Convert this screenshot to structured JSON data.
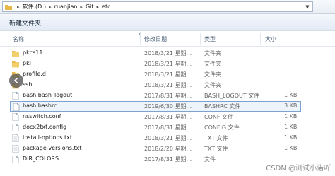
{
  "breadcrumb": [
    "软件 (D:)",
    "ruanjian",
    "Git",
    "etc"
  ],
  "toolbar": {
    "new_folder": "新建文件夹"
  },
  "columns": {
    "name": "名称",
    "modified": "修改日期",
    "type": "类型",
    "size": "大小"
  },
  "files": [
    {
      "name": "pkcs11",
      "modified": "2018/3/21 星期...",
      "type": "文件夹",
      "size": "",
      "kind": "folder"
    },
    {
      "name": "pki",
      "modified": "2018/3/21 星期...",
      "type": "文件夹",
      "size": "",
      "kind": "folder"
    },
    {
      "name": "profile.d",
      "modified": "2018/3/21 星期...",
      "type": "文件夹",
      "size": "",
      "kind": "folder"
    },
    {
      "name": "ssh",
      "modified": "2018/3/21 星期...",
      "type": "文件夹",
      "size": "",
      "kind": "folder"
    },
    {
      "name": "bash.bash_logout",
      "modified": "2017/8/31 星期...",
      "type": "BASH_LOGOUT 文件",
      "size": "1 KB",
      "kind": "file"
    },
    {
      "name": "bash.bashrc",
      "modified": "2019/6/30 星期...",
      "type": "BASHRC 文件",
      "size": "3 KB",
      "kind": "file",
      "selected": true
    },
    {
      "name": "nsswitch.conf",
      "modified": "2017/8/31 星期...",
      "type": "CONF 文件",
      "size": "1 KB",
      "kind": "file"
    },
    {
      "name": "docx2txt.config",
      "modified": "2017/8/31 星期...",
      "type": "CONFIG 文件",
      "size": "1 KB",
      "kind": "file"
    },
    {
      "name": "install-options.txt",
      "modified": "2018/3/21 星期...",
      "type": "TXT 文件",
      "size": "1 KB",
      "kind": "file"
    },
    {
      "name": "package-versions.txt",
      "modified": "2018/2/20 星期...",
      "type": "TXT 文件",
      "size": "1 KB",
      "kind": "file"
    },
    {
      "name": "DIR_COLORS",
      "modified": "2017/8/31 星期...",
      "type": "文件",
      "size": "",
      "kind": "file"
    }
  ],
  "watermark": "CSDN @测试小诺吖",
  "colors": {
    "folder": "#e8b84a",
    "selection_border": "#7da2ce",
    "selection_fill": "#eef4fb",
    "header_text": "#4c607a"
  }
}
